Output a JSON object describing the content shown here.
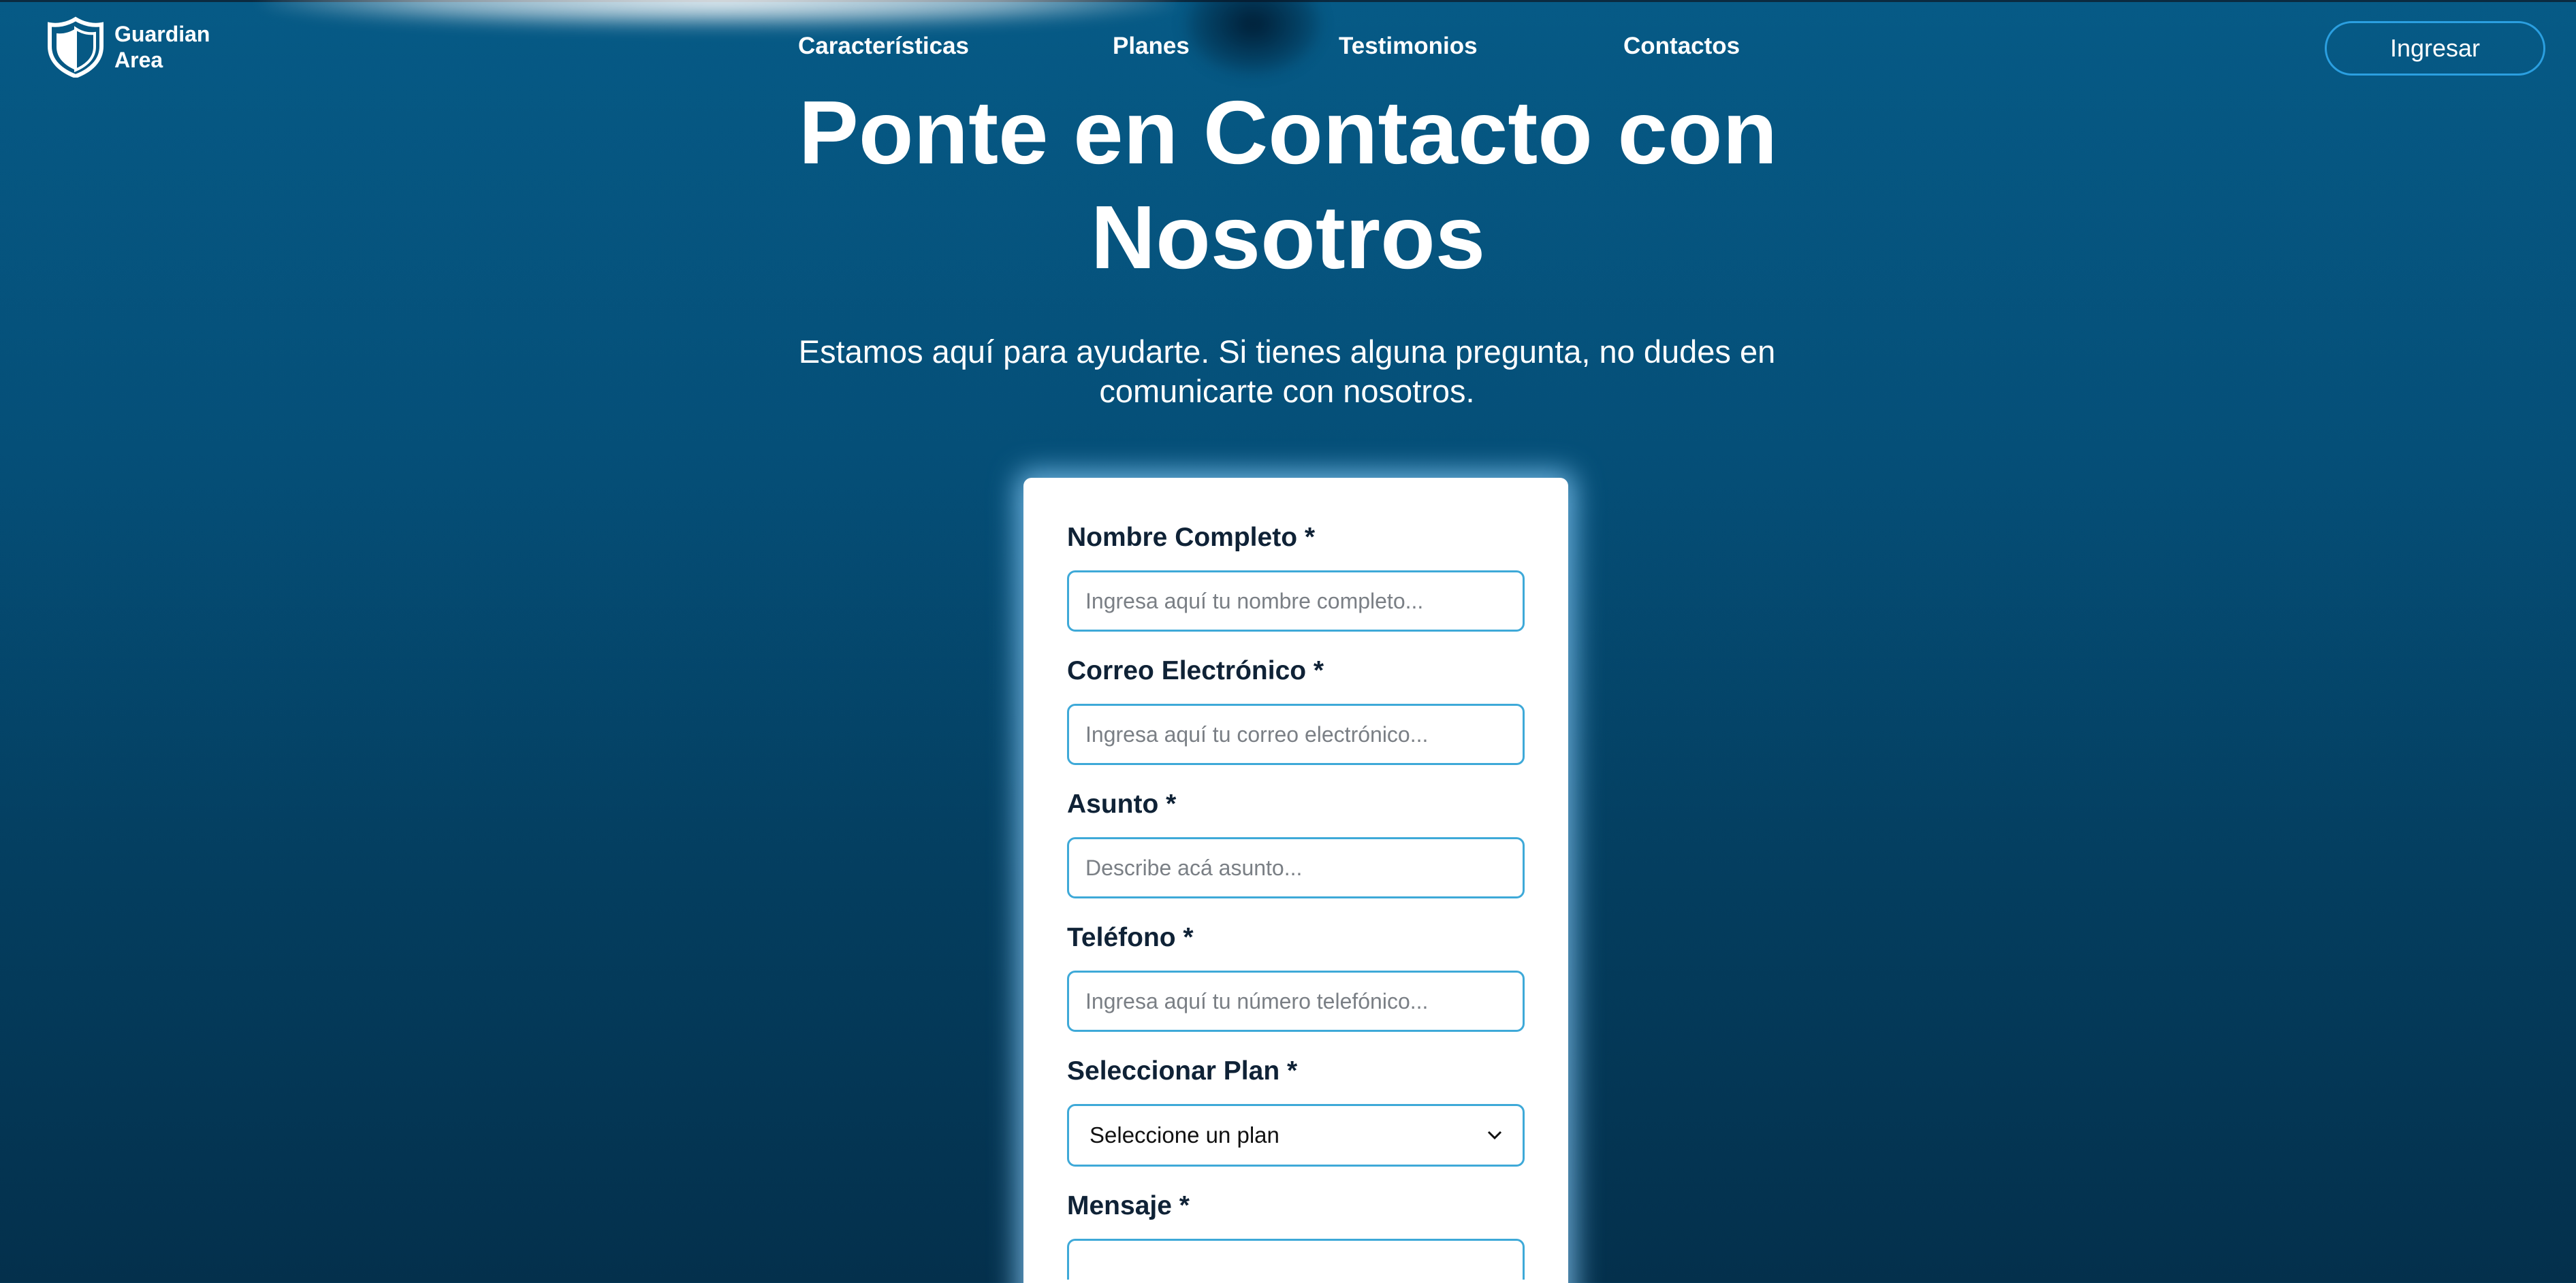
{
  "brand": {
    "name_line1": "Guardian",
    "name_line2": "Area"
  },
  "nav": {
    "items": [
      "Características",
      "Planes",
      "Testimonios",
      "Contactos"
    ],
    "login_label": "Ingresar"
  },
  "hero": {
    "title_line1": "Ponte en Contacto con",
    "title_line2": "Nosotros",
    "subtitle": "Estamos aquí para ayudarte. Si tienes alguna pregunta, no dudes en comunicarte con nosotros."
  },
  "form": {
    "name": {
      "label": "Nombre Completo *",
      "placeholder": "Ingresa aquí tu nombre completo..."
    },
    "email": {
      "label": "Correo Electrónico *",
      "placeholder": "Ingresa aquí tu correo electrónico..."
    },
    "subject": {
      "label": "Asunto *",
      "placeholder": "Describe acá asunto..."
    },
    "phone": {
      "label": "Teléfono *",
      "placeholder": "Ingresa aquí tu número telefónico..."
    },
    "plan": {
      "label": "Seleccionar Plan *",
      "selected": "Seleccione un plan"
    },
    "message": {
      "label": "Mensaje *"
    }
  },
  "colors": {
    "background_top": "#065a86",
    "background_bottom": "#04304c",
    "accent": "#2b9fe0",
    "input_border": "#3ea9d8",
    "label_text": "#0f2236"
  },
  "icons": {
    "logo": "shield-icon",
    "select": "chevron-down-icon"
  }
}
